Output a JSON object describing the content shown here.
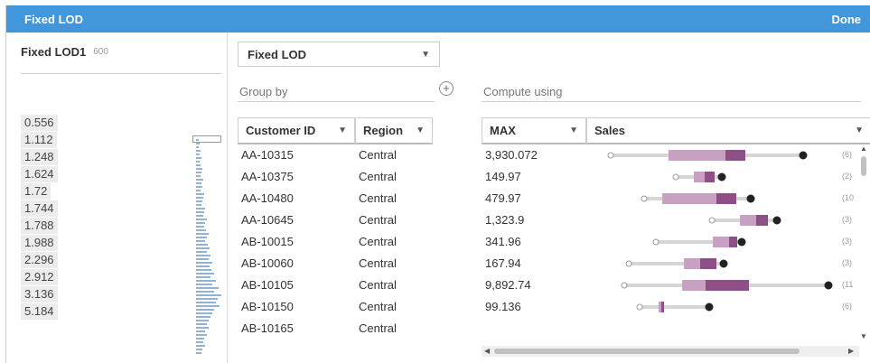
{
  "titlebar": {
    "title": "Fixed LOD",
    "done_label": "Done"
  },
  "left_panel": {
    "field_name": "Fixed LOD1",
    "field_count": "600",
    "values": [
      "0.556",
      "1.112",
      "1.248",
      "1.624",
      "1.72",
      "1.744",
      "1.788",
      "1.988",
      "2.296",
      "2.912",
      "3.136",
      "5.184"
    ]
  },
  "main": {
    "calc_type": "Fixed LOD",
    "group_by_label": "Group by",
    "compute_using_label": "Compute using",
    "columns": {
      "customer_id": "Customer ID",
      "region": "Region",
      "aggregation": "MAX",
      "measure": "Sales"
    },
    "rows": [
      {
        "customer_id": "AA-10315",
        "region": "Central",
        "value": "3,930.072",
        "count": "(6)"
      },
      {
        "customer_id": "AA-10375",
        "region": "Central",
        "value": "149.97",
        "count": "(2)"
      },
      {
        "customer_id": "AA-10480",
        "region": "Central",
        "value": "479.97",
        "count": "(10"
      },
      {
        "customer_id": "AA-10645",
        "region": "Central",
        "value": "1,323.9",
        "count": "(3)"
      },
      {
        "customer_id": "AB-10015",
        "region": "Central",
        "value": "341.96",
        "count": "(3)"
      },
      {
        "customer_id": "AB-10060",
        "region": "Central",
        "value": "167.94",
        "count": "(3)"
      },
      {
        "customer_id": "AB-10105",
        "region": "Central",
        "value": "9,892.74",
        "count": "(11"
      },
      {
        "customer_id": "AB-10150",
        "region": "Central",
        "value": "99.136",
        "count": "(6)"
      },
      {
        "customer_id": "AB-10165",
        "region": "Central",
        "value": "",
        "count": ""
      }
    ]
  },
  "colors": {
    "titlebar": "#4297da",
    "box_light": "#c7a0c2",
    "box_dark": "#8e4f86",
    "hist": "#8fb3d9"
  }
}
